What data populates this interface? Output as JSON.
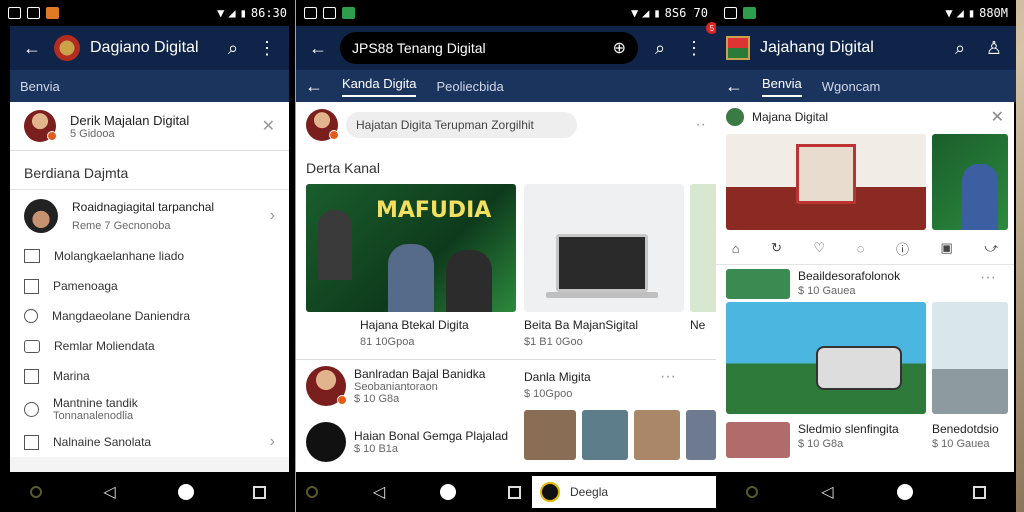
{
  "phone1": {
    "title": "Dagiano Digital",
    "status_time": "86:30",
    "section_label": "Benvia",
    "profile_name": "Derik Majalan Digital",
    "profile_sub": "5 Gidooa",
    "section2_title": "Berdiana Dajmta",
    "featured_title": "Roaidnagiagital tarpanchal",
    "featured_sub": "Reme 7 Gecnonoba",
    "menu": [
      {
        "label": "Molangkaelanhane liado",
        "sub": ""
      },
      {
        "label": "Pamenoaga",
        "sub": ""
      },
      {
        "label": "Mangdaeolane Daniendra",
        "sub": ""
      },
      {
        "label": "Remlar Moliendata",
        "sub": ""
      },
      {
        "label": "Marina",
        "sub": ""
      },
      {
        "label": "Mantnine tandik",
        "sub": "Tonnanalenodlia"
      },
      {
        "label": "Nalnaine Sanolata",
        "sub": ""
      }
    ]
  },
  "phone2": {
    "search_value": "JPS88 Tenang Digital",
    "status_time": "8S6 70",
    "badge": "5",
    "tab_active": "Kanda Digita",
    "tab_other": "Peoliecbida",
    "composer_placeholder": "Hajatan Digita Terupman Zorgilhit",
    "section_title": "Derta Kanal",
    "cards": [
      {
        "title": "Hajana Btekal Digita",
        "meta": "81 10Gpoa",
        "banner": "MAFUDIA"
      },
      {
        "title": "Beita Ba MajanSigital",
        "meta": "$1 B1 0Goo"
      },
      {
        "title": "Ne",
        "meta": ""
      }
    ],
    "posts": [
      {
        "title": "Banlradan Bajal Banidka",
        "sub": "Seobaniantoraon",
        "meta": "$ 10 G8a"
      },
      {
        "title": "Haian Bonal Gemga Plajalad",
        "sub": "",
        "meta": "$ 10 B1a"
      }
    ],
    "side_title": "Danla Migita",
    "side_meta": "$ 10Gpoo",
    "footer_item": "Deegla"
  },
  "phone3": {
    "title": "Jajahang Digital",
    "status_time": "880M",
    "tab_active": "Benvia",
    "tab_other": "Wgoncam",
    "card_title": "Majana Digital",
    "list_title": "Beaildesorafolonok",
    "list_meta": "$ 10 Gauea",
    "list2_title": "Sledmio slenfingita",
    "list2_meta": "$ 10 G8a",
    "list3_title": "Benedotdsio",
    "list3_meta": "$ 10 Gauea"
  },
  "colors": {
    "appbar": "#0f2448",
    "tabbar": "#1b345e",
    "accent": "#e45b1a"
  }
}
